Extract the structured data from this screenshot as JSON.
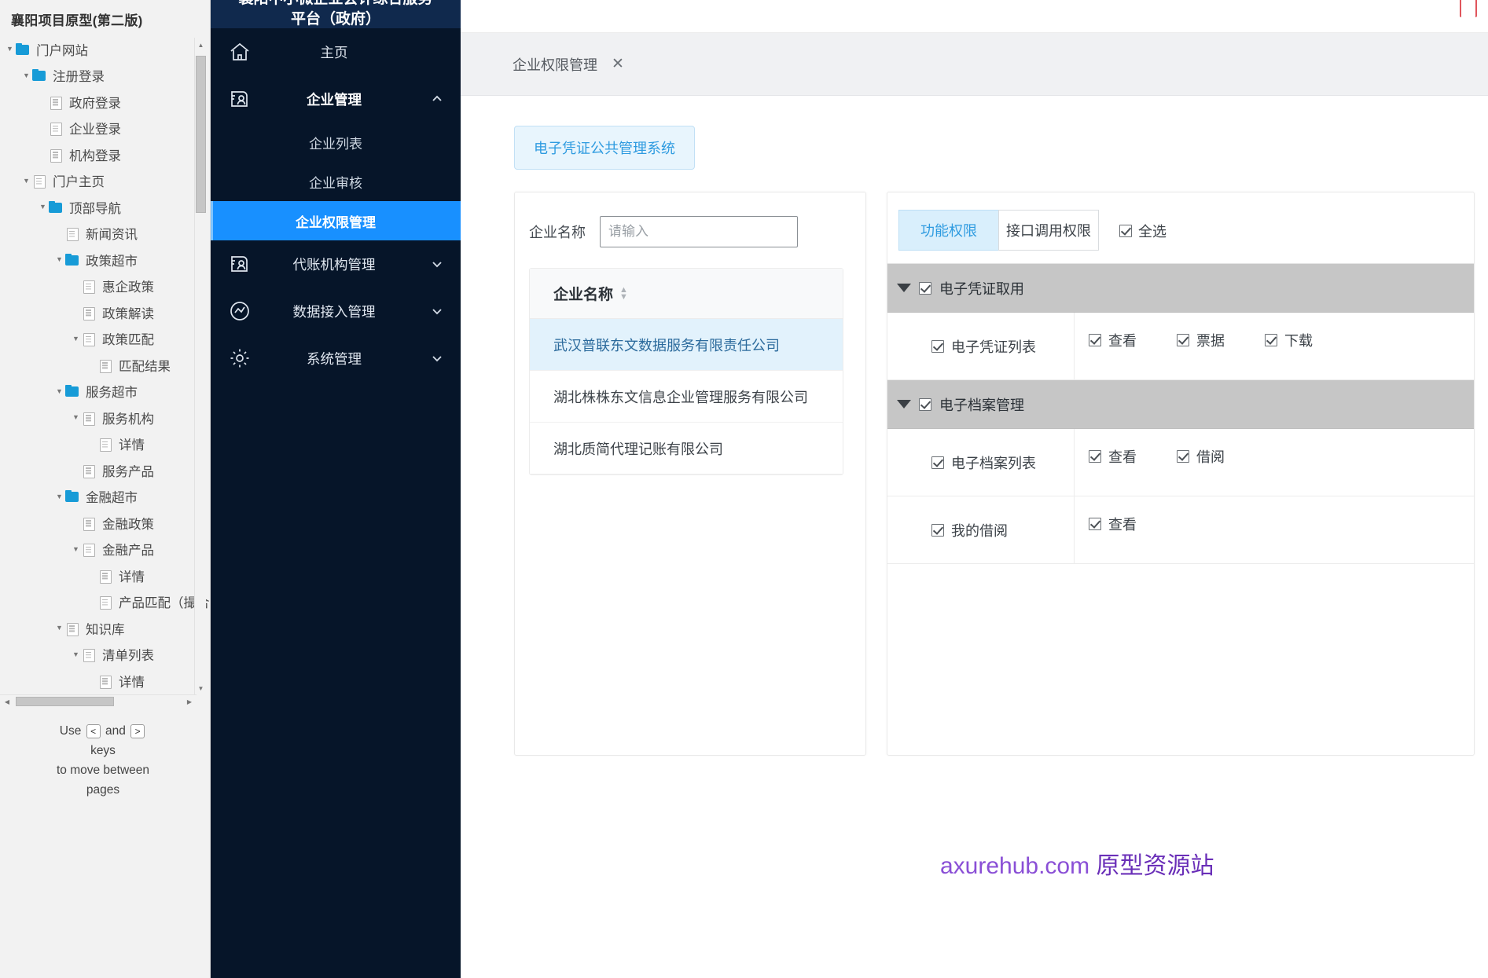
{
  "sitemap": {
    "title": "襄阳项目原型(第二版)",
    "nodes": [
      {
        "label": "门户网站",
        "depth": 0,
        "icon": "folder",
        "expanded": true
      },
      {
        "label": "注册登录",
        "depth": 1,
        "icon": "folder",
        "expanded": true
      },
      {
        "label": "政府登录",
        "depth": 2,
        "icon": "page",
        "expanded": null
      },
      {
        "label": "企业登录",
        "depth": 2,
        "icon": "page",
        "expanded": null
      },
      {
        "label": "机构登录",
        "depth": 2,
        "icon": "page",
        "expanded": null
      },
      {
        "label": "门户主页",
        "depth": 1,
        "icon": "page",
        "expanded": true
      },
      {
        "label": "顶部导航",
        "depth": 2,
        "icon": "folder",
        "expanded": true
      },
      {
        "label": "新闻资讯",
        "depth": 3,
        "icon": "page",
        "expanded": null
      },
      {
        "label": "政策超市",
        "depth": 3,
        "icon": "folder",
        "expanded": true
      },
      {
        "label": "惠企政策",
        "depth": 4,
        "icon": "page",
        "expanded": null
      },
      {
        "label": "政策解读",
        "depth": 4,
        "icon": "page",
        "expanded": null
      },
      {
        "label": "政策匹配",
        "depth": 4,
        "icon": "page",
        "expanded": true
      },
      {
        "label": "匹配结果",
        "depth": 5,
        "icon": "page",
        "expanded": null
      },
      {
        "label": "服务超市",
        "depth": 3,
        "icon": "folder",
        "expanded": true
      },
      {
        "label": "服务机构",
        "depth": 4,
        "icon": "page",
        "expanded": true
      },
      {
        "label": "详情",
        "depth": 5,
        "icon": "page",
        "expanded": null
      },
      {
        "label": "服务产品",
        "depth": 4,
        "icon": "page",
        "expanded": null
      },
      {
        "label": "金融超市",
        "depth": 3,
        "icon": "folder",
        "expanded": true
      },
      {
        "label": "金融政策",
        "depth": 4,
        "icon": "page",
        "expanded": null
      },
      {
        "label": "金融产品",
        "depth": 4,
        "icon": "page",
        "expanded": true
      },
      {
        "label": "详情",
        "depth": 5,
        "icon": "page",
        "expanded": null
      },
      {
        "label": "产品匹配（撮合",
        "depth": 5,
        "icon": "page",
        "expanded": null
      },
      {
        "label": "知识库",
        "depth": 3,
        "icon": "page",
        "expanded": true
      },
      {
        "label": "清单列表",
        "depth": 4,
        "icon": "page",
        "expanded": true
      },
      {
        "label": "详情",
        "depth": 5,
        "icon": "page",
        "expanded": null
      }
    ],
    "hint_line1_pre": "Use",
    "hint_key_prev": "<",
    "hint_and": "and",
    "hint_key_next": ">",
    "hint_line2": "keys",
    "hint_line3": "to move between",
    "hint_line4": "pages"
  },
  "nav": {
    "title_line1": "襄阳中小微企业会计综合服务",
    "title_line2": "平台（政府）",
    "items": [
      {
        "label": "主页",
        "icon": "home-icon",
        "type": "item",
        "chevron": ""
      },
      {
        "label": "企业管理",
        "icon": "enterprise-icon",
        "type": "parent",
        "chevron": "up"
      },
      {
        "label": "企业列表",
        "icon": "",
        "type": "sub",
        "chevron": ""
      },
      {
        "label": "企业审核",
        "icon": "",
        "type": "sub",
        "chevron": ""
      },
      {
        "label": "企业权限管理",
        "icon": "",
        "type": "sub-active",
        "chevron": ""
      },
      {
        "label": "代账机构管理",
        "icon": "agency-icon",
        "type": "item",
        "chevron": "down"
      },
      {
        "label": "数据接入管理",
        "icon": "data-icon",
        "type": "item",
        "chevron": "down"
      },
      {
        "label": "系统管理",
        "icon": "gear-icon",
        "type": "item",
        "chevron": "down"
      }
    ]
  },
  "workspace": {
    "tab_label": "企业权限管理",
    "tab_close": "✕",
    "system_chip": "电子凭证公共管理系统",
    "search": {
      "label": "企业名称",
      "placeholder": "请输入",
      "value": ""
    },
    "enterprise_table": {
      "column_header": "企业名称",
      "rows": [
        {
          "name": "武汉普联东文数据服务有限责任公司",
          "selected": true
        },
        {
          "name": "湖北株株东文信息企业管理服务有限公司",
          "selected": false
        },
        {
          "name": "湖北质简代理记账有限公司",
          "selected": false
        }
      ]
    },
    "permissions": {
      "tabs": [
        {
          "label": "功能权限",
          "active": true
        },
        {
          "label": "接口调用权限",
          "active": false
        }
      ],
      "select_all": {
        "label": "全选",
        "checked": true
      },
      "groups": [
        {
          "label": "电子凭证取用",
          "checked": true,
          "expanded": true,
          "rows": [
            {
              "label": "电子凭证列表",
              "checked": true,
              "options": [
                {
                  "label": "查看",
                  "checked": true
                },
                {
                  "label": "票据",
                  "checked": true
                },
                {
                  "label": "下载",
                  "checked": true
                }
              ]
            }
          ]
        },
        {
          "label": "电子档案管理",
          "checked": true,
          "expanded": true,
          "rows": [
            {
              "label": "电子档案列表",
              "checked": true,
              "options": [
                {
                  "label": "查看",
                  "checked": true
                },
                {
                  "label": "借阅",
                  "checked": true
                }
              ]
            },
            {
              "label": "我的借阅",
              "checked": true,
              "options": [
                {
                  "label": "查看",
                  "checked": true
                }
              ]
            }
          ]
        }
      ]
    },
    "watermark_part1": "axurehub.com ",
    "watermark_part2": "原型资源站"
  }
}
